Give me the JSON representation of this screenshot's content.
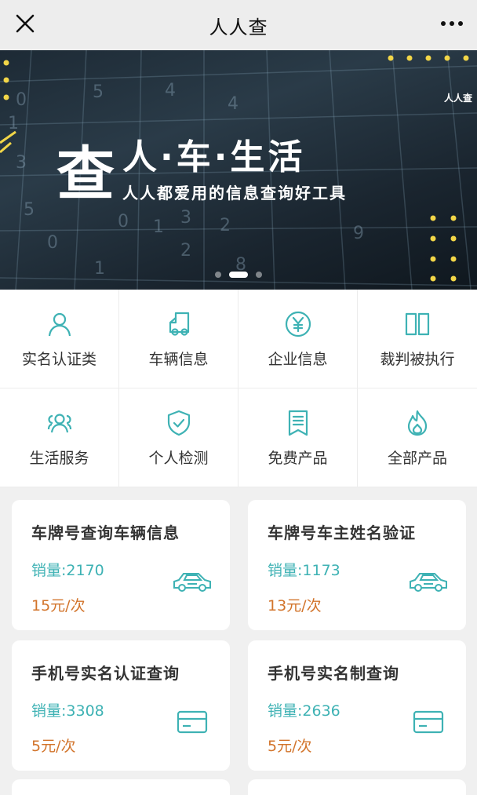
{
  "header": {
    "title": "人人查"
  },
  "banner": {
    "big_char": "查",
    "slogan": "人·车·生活",
    "subslogan": "人人都爱用的信息查询好工具",
    "brand": "人人查",
    "slide_count": 3,
    "active_slide": 2
  },
  "menu": {
    "items": [
      {
        "label": "实名认证类",
        "icon": "person-icon"
      },
      {
        "label": "车辆信息",
        "icon": "truck-icon"
      },
      {
        "label": "企业信息",
        "icon": "yen-icon"
      },
      {
        "label": "裁判被执行",
        "icon": "book-icon"
      },
      {
        "label": "生活服务",
        "icon": "group-icon"
      },
      {
        "label": "个人检测",
        "icon": "shield-check-icon"
      },
      {
        "label": "免费产品",
        "icon": "bookmark-icon"
      },
      {
        "label": "全部产品",
        "icon": "flame-icon"
      }
    ]
  },
  "products": [
    {
      "title": "车牌号查询车辆信息",
      "sales": "销量:2170",
      "price": "15元/次",
      "icon": "car-icon"
    },
    {
      "title": "车牌号车主姓名验证",
      "sales": "销量:1173",
      "price": "13元/次",
      "icon": "car-icon"
    },
    {
      "title": "手机号实名认证查询",
      "sales": "销量:3308",
      "price": "5元/次",
      "icon": "card-icon"
    },
    {
      "title": "手机号实名制查询",
      "sales": "销量:2636",
      "price": "5元/次",
      "icon": "card-icon"
    }
  ],
  "colors": {
    "accent": "#3eb2b4",
    "price": "#d2742b",
    "banner_dots": "#f2d648"
  }
}
